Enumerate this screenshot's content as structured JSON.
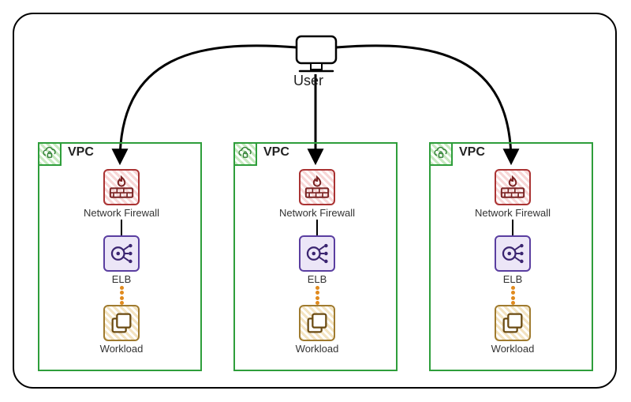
{
  "user_label": "User",
  "vpc": {
    "title": "VPC",
    "firewall_label": "Network Firewall",
    "elb_label": "ELB",
    "workload_label": "Workload"
  },
  "colors": {
    "vpc_border": "#2e9e3b",
    "firewall": "#a33",
    "elb": "#5a3ea0",
    "workload": "#a07b2f",
    "dotted": "#e08a1e"
  }
}
